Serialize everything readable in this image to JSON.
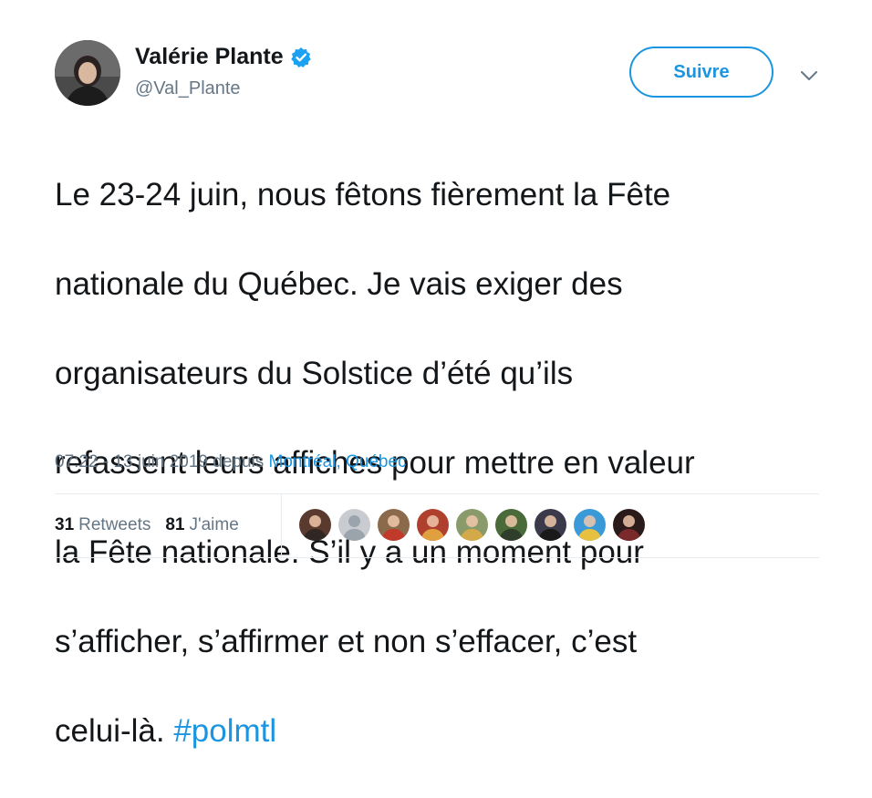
{
  "author": {
    "display_name": "Valérie Plante",
    "handle": "@Val_Plante",
    "verified": true,
    "avatar_icon": "profile-photo"
  },
  "follow_button": {
    "label": "Suivre"
  },
  "menu_icon": "chevron-down-icon",
  "tweet": {
    "text_lines": [
      "Le 23-24 juin, nous fêtons fièrement la Fête",
      "nationale du Québec. Je vais exiger des",
      "organisateurs du Solstice d’été qu’ils",
      "refassent leurs affiches pour mettre en valeur",
      "la Fête nationale. S’il y a un moment pour",
      "s’afficher, s’affirmer et non s’effacer, c’est"
    ],
    "last_line_text": "celui-là.",
    "hashtag": "#polmtl"
  },
  "meta": {
    "time_date": "07:22 - 13 juin 2019",
    "via": "depuis",
    "location": "Montréal, Québec"
  },
  "stats": {
    "retweets_count": "31",
    "retweets_label": "Retweets",
    "likes_count": "81",
    "likes_label": "J'aime"
  },
  "likers_count": 9,
  "colors": {
    "accent": "#1b95e0",
    "text": "#14171a",
    "secondary": "#657786",
    "divider": "#e6ecf0"
  }
}
